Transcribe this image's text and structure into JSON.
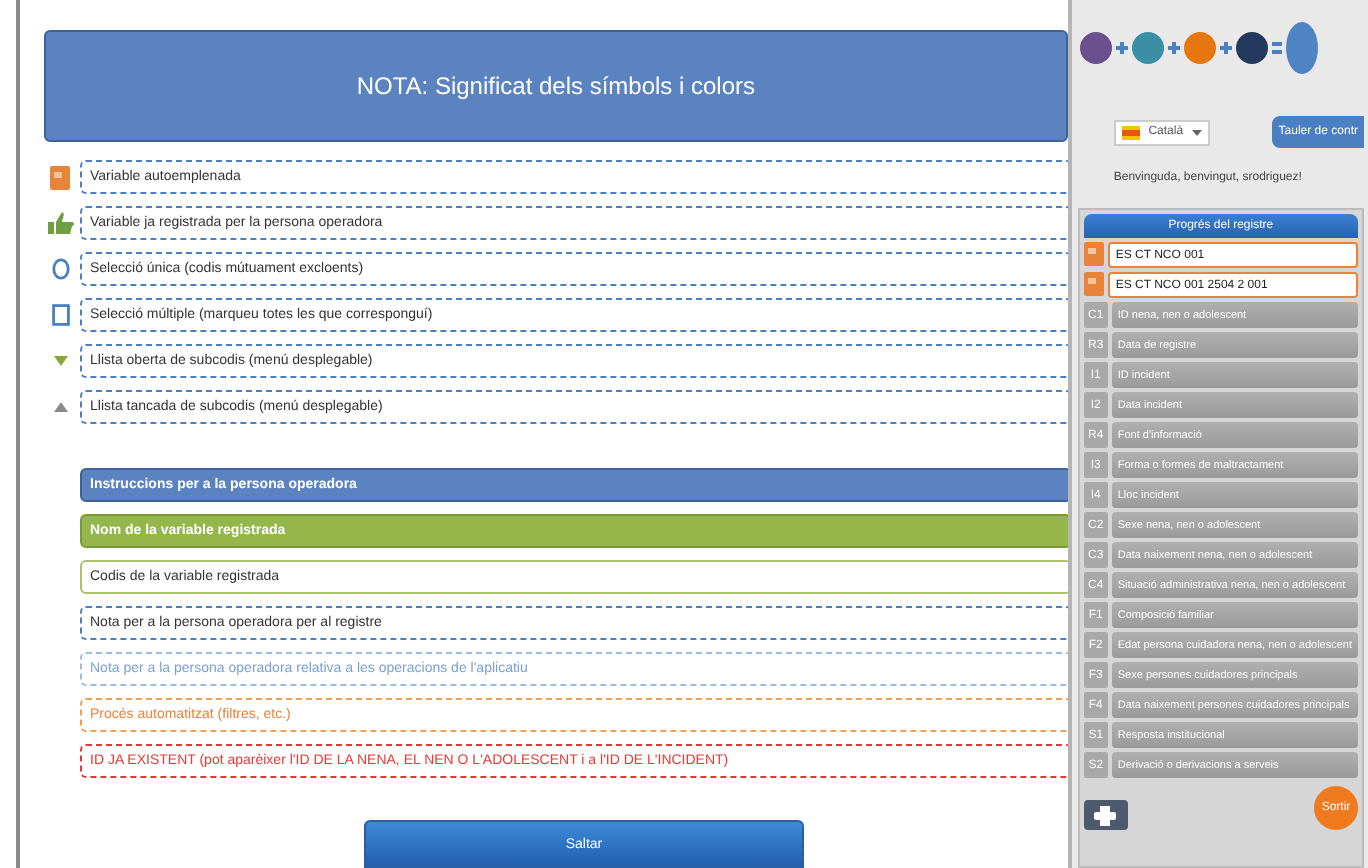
{
  "header": {
    "title": "NOTA: Significat dels símbols i colors"
  },
  "symbols": [
    {
      "kind": "autofill",
      "label": "Variable autoemplenada"
    },
    {
      "kind": "registered",
      "label": "Variable ja registrada per la persona operadora"
    },
    {
      "kind": "radio",
      "label": "Selecció única (codis mútuament excloents)"
    },
    {
      "kind": "checkbox",
      "label": "Selecció múltiple (marqueu totes les que corresponguí)"
    },
    {
      "kind": "open-list",
      "label": "Llista oberta de subcodis (menú desplegable)"
    },
    {
      "kind": "closed-list",
      "label": "Llista tancada de subcodis (menú desplegable)"
    }
  ],
  "colors": [
    {
      "kind": "instructions",
      "label": "Instruccions per a la persona operadora"
    },
    {
      "kind": "variable-name",
      "label": "Nom de la variable registrada"
    },
    {
      "kind": "code",
      "label": "Codis de la variable registrada"
    },
    {
      "kind": "note",
      "label": "Nota per a la persona operadora per al registre"
    },
    {
      "kind": "app-note",
      "label": "Nota per a la persona operadora relativa a les operacions de l'aplicatiu"
    },
    {
      "kind": "auto",
      "label": "Procés automatitzat (filtres, etc.)"
    },
    {
      "kind": "existing",
      "label": "ID JA EXISTENT (pot aparèixer l'ID DE LA NENA, EL NEN O L'ADOLESCENT i a l'ID DE L'INCIDENT)"
    }
  ],
  "skip_button": "Saltar",
  "sidebar": {
    "language": "Català",
    "dashboard_button": "Tauler de contr",
    "welcome": "Benvinguda, benvingut, srodriguez!",
    "progress_title": "Progrés del registre",
    "ids": [
      "ES CT NCO 001",
      "ES CT NCO 001 2504 2 001"
    ],
    "items": [
      {
        "code": "C1",
        "label": "ID nena, nen o adolescent"
      },
      {
        "code": "R3",
        "label": "Data de registre"
      },
      {
        "code": "I1",
        "label": "ID incident"
      },
      {
        "code": "I2",
        "label": "Data incident"
      },
      {
        "code": "R4",
        "label": "Font d'informació"
      },
      {
        "code": "I3",
        "label": "Forma o formes de maltractament"
      },
      {
        "code": "I4",
        "label": "Lloc incident"
      },
      {
        "code": "C2",
        "label": "Sexe nena, nen o adolescent"
      },
      {
        "code": "C3",
        "label": "Data naixement nena, nen o adolescent"
      },
      {
        "code": "C4",
        "label": "Situació administrativa nena, nen o adolescent"
      },
      {
        "code": "F1",
        "label": "Composició familiar"
      },
      {
        "code": "F2",
        "label": "Edat persona cuidadora nena, nen o adolescent"
      },
      {
        "code": "F3",
        "label": "Sexe persones cuidadores principals"
      },
      {
        "code": "F4",
        "label": "Data naixement persones cuidadores principals"
      },
      {
        "code": "S1",
        "label": "Resposta institucional"
      },
      {
        "code": "S2",
        "label": "Derivació o derivacions a serveis"
      }
    ],
    "exit_button": "Sortir"
  }
}
